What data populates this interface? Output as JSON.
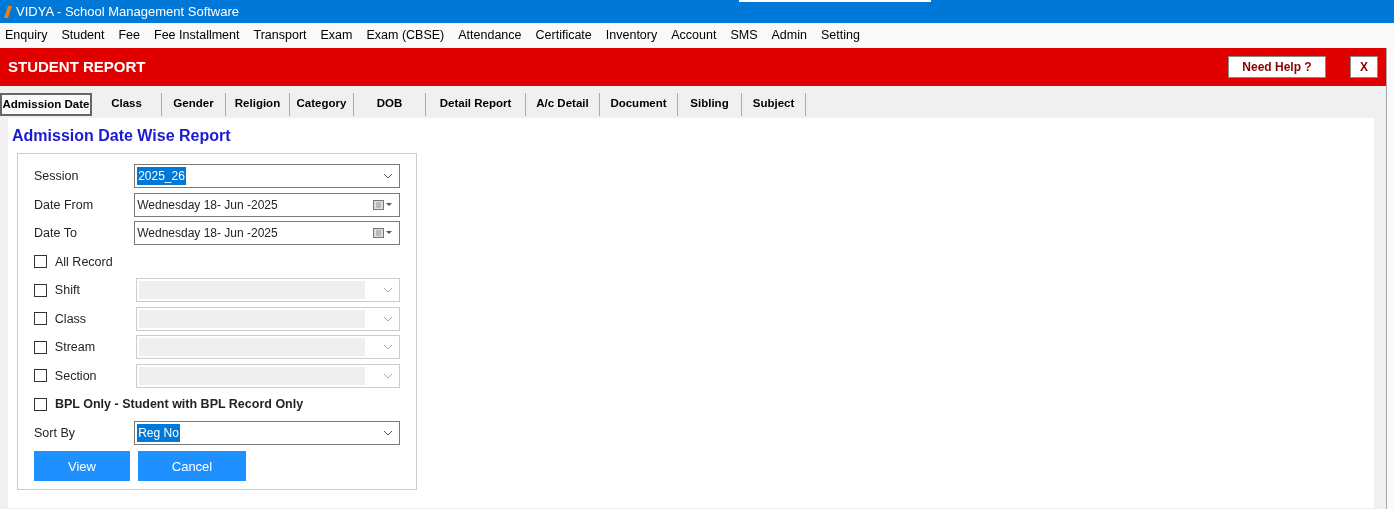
{
  "window": {
    "title": "VIDYA - School Management Software"
  },
  "menu": [
    "Enquiry",
    "Student",
    "Fee",
    "Fee Installment",
    "Transport",
    "Exam",
    "Exam (CBSE)",
    "Attendance",
    "Certificate",
    "Inventory",
    "Account",
    "SMS",
    "Admin",
    "Setting"
  ],
  "header": {
    "title": "STUDENT REPORT",
    "help_button": "Need Help ?",
    "close_button": "X"
  },
  "tabs": [
    {
      "label": "Admission Date",
      "selected": true
    },
    {
      "label": "Class",
      "selected": false
    },
    {
      "label": "Gender",
      "selected": false
    },
    {
      "label": "Religion",
      "selected": false
    },
    {
      "label": "Category",
      "selected": false
    },
    {
      "label": "DOB",
      "selected": false
    },
    {
      "label": "Detail Report",
      "selected": false
    },
    {
      "label": "A/c Detail",
      "selected": false
    },
    {
      "label": "Document",
      "selected": false
    },
    {
      "label": "Sibling",
      "selected": false
    },
    {
      "label": "Subject",
      "selected": false
    }
  ],
  "panel": {
    "title": "Admission Date Wise Report",
    "rows": [
      {
        "kind": "select",
        "label": "Session",
        "value": "2025_26",
        "highlighted": true
      },
      {
        "kind": "date",
        "label": "Date From",
        "value": "Wednesday 18- Jun -2025"
      },
      {
        "kind": "date",
        "label": "Date To",
        "value": "Wednesday 18- Jun -2025"
      },
      {
        "kind": "check",
        "label": "All Record",
        "checked": false
      },
      {
        "kind": "check-select",
        "label": "Shift",
        "checked": false,
        "disabled": true
      },
      {
        "kind": "check-select",
        "label": "Class",
        "checked": false,
        "disabled": true
      },
      {
        "kind": "check-select",
        "label": "Stream",
        "checked": false,
        "disabled": true
      },
      {
        "kind": "check-select",
        "label": "Section",
        "checked": false,
        "disabled": true
      },
      {
        "kind": "check",
        "label": "BPL Only - Student with BPL Record Only",
        "checked": false,
        "bold": true
      },
      {
        "kind": "select",
        "label": "Sort By",
        "value": "Reg No",
        "highlighted": true
      }
    ],
    "buttons": [
      "View",
      "Cancel"
    ]
  }
}
